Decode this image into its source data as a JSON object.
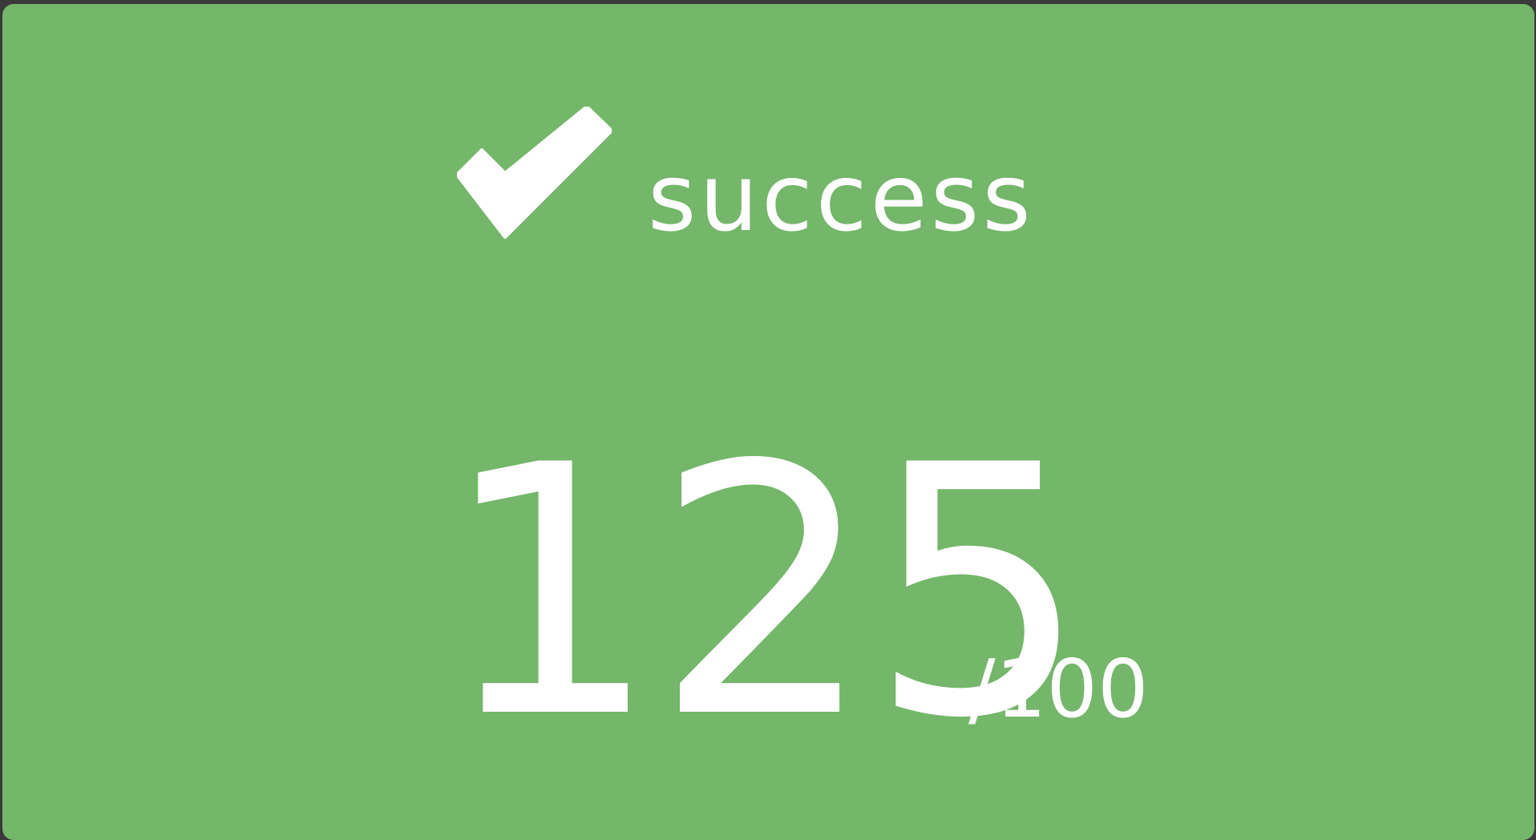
{
  "theme": {
    "card_background": "#74b66a",
    "text_color": "#ffffff",
    "window_border": "#3a3a3a"
  },
  "header": {
    "icon": "check-icon",
    "status_label": "success"
  },
  "score": {
    "value": "125",
    "max": "/100"
  }
}
